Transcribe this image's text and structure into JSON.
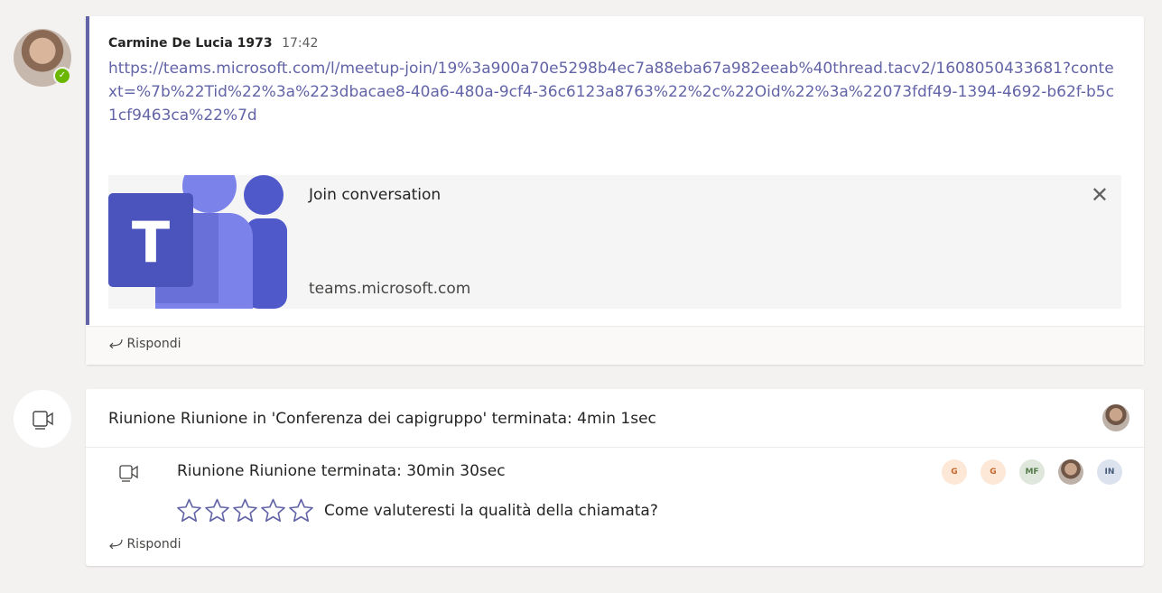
{
  "post": {
    "author": "Carmine De Lucia 1973",
    "time": "17:42",
    "link": "https://teams.microsoft.com/l/meetup-join/19%3a900a70e5298b4ec7a88eba67a982eeab%40thread.tacv2/1608050433681?context=%7b%22Tid%22%3a%223dbacae8-40a6-480a-9cf4-36c6123a8763%22%2c%22Oid%22%3a%22073fdf49-1394-4692-b62f-b5c1cf9463ca%22%7d",
    "preview_title": "Join conversation",
    "preview_domain": "teams.microsoft.com",
    "close_glyph": "✕",
    "reply_label": "Rispondi",
    "presence": "available"
  },
  "meeting": {
    "header_title": "Riunione Riunione in 'Conferenza dei capigruppo' terminata: 4min 1sec",
    "sub_title": "Riunione Riunione terminata: 30min 30sec",
    "rating_question": "Come valuteresti la qualità della chiamata?",
    "stars_count": 5,
    "reply_label": "Rispondi",
    "participants": [
      {
        "initials": "G",
        "bg": "#fde7d6",
        "fg": "#c4662b"
      },
      {
        "initials": "G",
        "bg": "#fde7d6",
        "fg": "#c4662b"
      },
      {
        "initials": "MF",
        "bg": "#dfe7dc",
        "fg": "#557a4a"
      },
      {
        "initials": "",
        "bg": "photo",
        "fg": ""
      },
      {
        "initials": "IN",
        "bg": "#dde3ee",
        "fg": "#465a7a"
      }
    ]
  },
  "colors": {
    "accent": "#6264a7",
    "presence_green": "#6bb700",
    "background": "#f3f2f1"
  },
  "icons": {
    "reply": "reply-arrow-icon",
    "meeting": "video-camera-icon",
    "close": "close-icon",
    "star": "star-outline-icon",
    "logo": "microsoft-teams-logo"
  }
}
